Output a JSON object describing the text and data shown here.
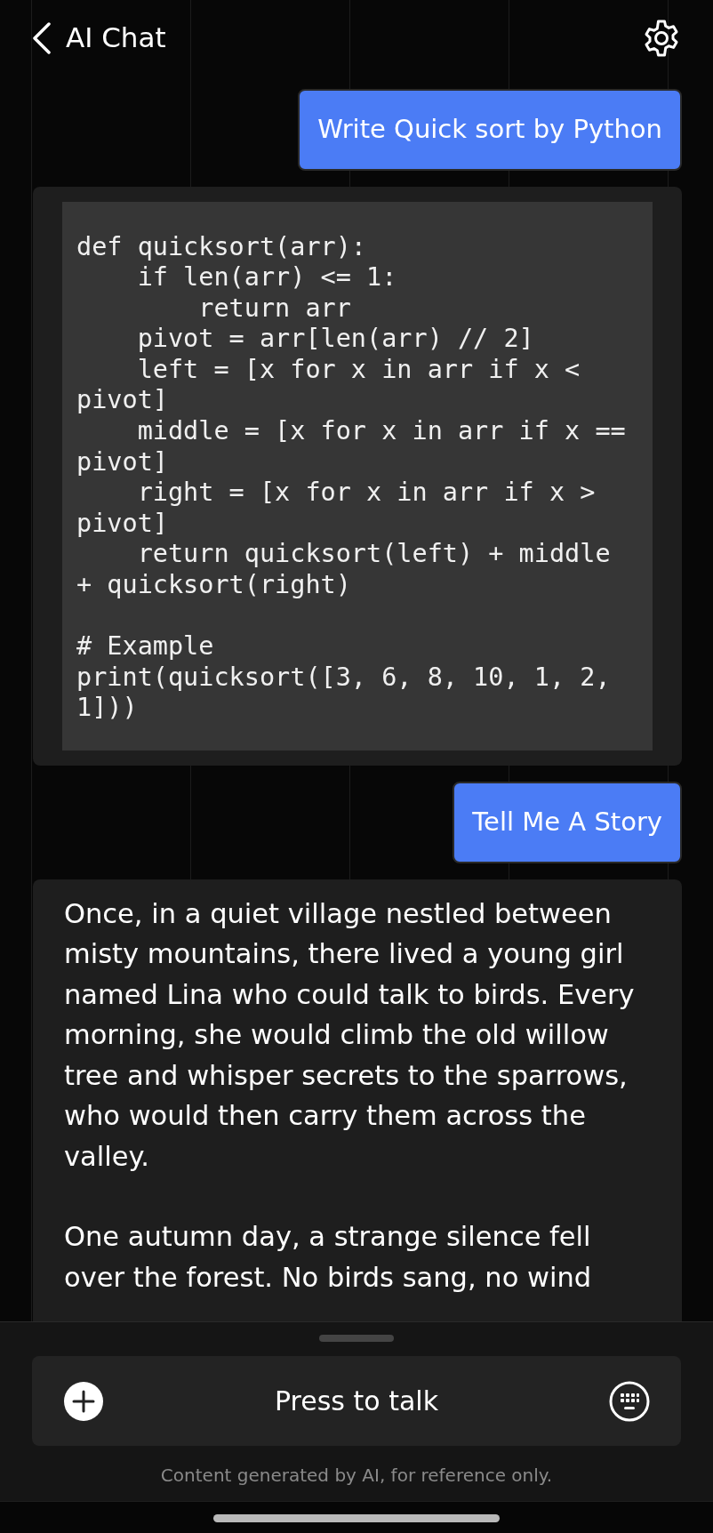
{
  "header": {
    "title": "AI Chat"
  },
  "messages": [
    {
      "kind": "user",
      "text": "Write Quick sort by Python"
    },
    {
      "kind": "code",
      "blocks": [
        [
          "def quicksort(arr):",
          "    if len(arr) <= 1:",
          "        return arr",
          "    pivot = arr[len(arr) // 2]",
          "    left = [x for x in arr if x <",
          "pivot]",
          "    middle = [x for x in arr if x ==",
          "pivot]",
          "    right = [x for x in arr if x >",
          "pivot]",
          "    return quicksort(left) + middle",
          "+ quicksort(right)"
        ],
        [
          "# Example",
          "print(quicksort([3, 6, 8, 10, 1, 2,",
          "1]))"
        ]
      ]
    },
    {
      "kind": "user",
      "text": "Tell Me A Story"
    },
    {
      "kind": "bot",
      "paragraphs": [
        "Once, in a quiet village nestled between misty mountains, there lived a young girl named Lina who could talk to birds. Every morning, she would climb the old willow tree and whisper secrets to the sparrows, who would then carry them across the valley.",
        "One autumn day, a strange silence fell over the forest. No birds sang, no wind"
      ]
    }
  ],
  "input": {
    "label": "Press to talk"
  },
  "footer": "Content generated by AI, for reference only."
}
